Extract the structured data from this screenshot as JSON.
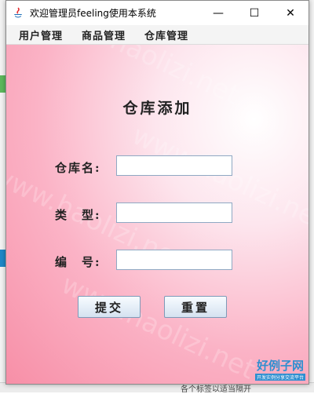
{
  "window": {
    "title": "欢迎管理员feeling使用本系统",
    "controls": {
      "minimize": "—",
      "maximize": "☐",
      "close": "✕"
    }
  },
  "menu": {
    "items": [
      "用户管理",
      "商品管理",
      "仓库管理"
    ]
  },
  "form": {
    "title": "仓库添加",
    "fields": [
      {
        "label": "仓库名:",
        "value": ""
      },
      {
        "label": "类　型:",
        "value": ""
      },
      {
        "label": "编　号:",
        "value": ""
      }
    ],
    "submit_label": "提交",
    "reset_label": "重置"
  },
  "watermark": "www.haolizi.net",
  "logo": {
    "main": "好例子网",
    "sub": "开发实例分享交流平台"
  },
  "background_app": {
    "status_text": "各个标签以适当隔开"
  },
  "colors": {
    "gradient_pink": "#f78fa7",
    "button_border": "#7e9ab8",
    "logo_blue": "#2f8fd0"
  }
}
